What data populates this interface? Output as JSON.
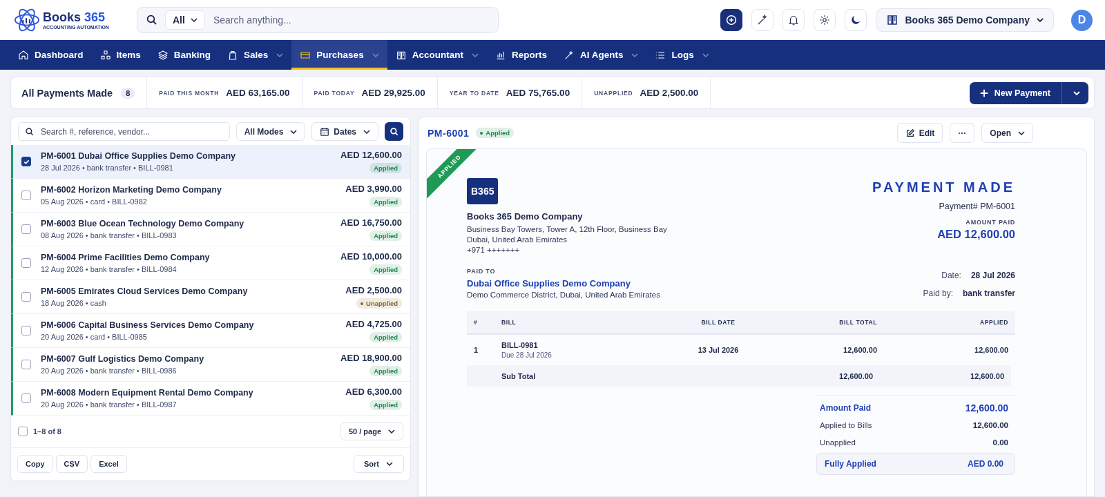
{
  "header": {
    "logo": {
      "word": "Books",
      "number": "365",
      "tagline": "ACCOUNTING AUTOMATION"
    },
    "search": {
      "scope": "All",
      "placeholder": "Search anything..."
    },
    "company": "Books 365 Demo Company",
    "avatar": "D"
  },
  "nav": [
    {
      "label": "Dashboard",
      "has_menu": false,
      "selected": false
    },
    {
      "label": "Items",
      "has_menu": false,
      "selected": false
    },
    {
      "label": "Banking",
      "has_menu": false,
      "selected": false
    },
    {
      "label": "Sales",
      "has_menu": true,
      "selected": false
    },
    {
      "label": "Purchases",
      "has_menu": true,
      "selected": true
    },
    {
      "label": "Accountant",
      "has_menu": true,
      "selected": false
    },
    {
      "label": "Reports",
      "has_menu": false,
      "selected": false
    },
    {
      "label": "AI Agents",
      "has_menu": true,
      "selected": false
    },
    {
      "label": "Logs",
      "has_menu": true,
      "selected": false
    }
  ],
  "summary": {
    "title": "All Payments Made",
    "count": "8",
    "metrics": [
      {
        "label": "PAID THIS MONTH",
        "value": "AED 63,165.00"
      },
      {
        "label": "PAID TODAY",
        "value": "AED 29,925.00"
      },
      {
        "label": "YEAR TO DATE",
        "value": "AED 75,765.00"
      },
      {
        "label": "UNAPPLIED",
        "value": "AED 2,500.00"
      }
    ],
    "new_button": "New Payment"
  },
  "list": {
    "search_placeholder": "Search #, reference, vendor...",
    "mode_filter": "All Modes",
    "date_filter": "Dates",
    "rows": [
      {
        "title": "PM-6001 Dubai Office Supplies Demo Company",
        "meta": "28 Jul 2026 • bank transfer • BILL-0981",
        "amount": "AED 12,600.00",
        "status": "Applied",
        "color": "#1e8a4f",
        "dot": false,
        "checked": true,
        "selected": true
      },
      {
        "title": "PM-6002 Horizon Marketing Demo Company",
        "meta": "05 Aug 2026 • card • BILL-0982",
        "amount": "AED 3,990.00",
        "status": "Applied",
        "color": "#1e8a4f",
        "dot": false,
        "checked": false,
        "selected": false
      },
      {
        "title": "PM-6003 Blue Ocean Technology Demo Company",
        "meta": "08 Aug 2026 • bank transfer • BILL-0983",
        "amount": "AED 16,750.00",
        "status": "Applied",
        "color": "#1e8a4f",
        "dot": false,
        "checked": false,
        "selected": false
      },
      {
        "title": "PM-6004 Prime Facilities Demo Company",
        "meta": "12 Aug 2026 • bank transfer • BILL-0984",
        "amount": "AED 10,000.00",
        "status": "Applied",
        "color": "#1e8a4f",
        "dot": false,
        "checked": false,
        "selected": false
      },
      {
        "title": "PM-6005 Emirates Cloud Services Demo Company",
        "meta": "18 Aug 2026 • cash",
        "amount": "AED 2,500.00",
        "status": "Unapplied",
        "color": "#8a6a2a",
        "dot": true,
        "checked": false,
        "selected": false
      },
      {
        "title": "PM-6006 Capital Business Services Demo Company",
        "meta": "20 Aug 2026 • card • BILL-0985",
        "amount": "AED 4,725.00",
        "status": "Applied",
        "color": "#1e8a4f",
        "dot": false,
        "checked": false,
        "selected": false
      },
      {
        "title": "PM-6007 Gulf Logistics Demo Company",
        "meta": "20 Aug 2026 • bank transfer • BILL-0986",
        "amount": "AED 18,900.00",
        "status": "Applied",
        "color": "#1e8a4f",
        "dot": false,
        "checked": false,
        "selected": false
      },
      {
        "title": "PM-6008 Modern Equipment Rental Demo Company",
        "meta": "20 Aug 2026 • bank transfer • BILL-0987",
        "amount": "AED 6,300.00",
        "status": "Applied",
        "color": "#1e8a4f",
        "dot": false,
        "checked": false,
        "selected": false
      }
    ],
    "select_all_checked": false,
    "range": "1–8 of 8",
    "page_size": "50 / page",
    "export_buttons": [
      "Copy",
      "CSV",
      "Excel"
    ],
    "sort": "Sort"
  },
  "detail": {
    "number": "PM-6001",
    "status": "Applied",
    "color": "#1e8a4f",
    "dot": true,
    "actions": {
      "edit": "Edit",
      "more": "···",
      "open": "Open"
    },
    "document": {
      "ribbon": "APPLIED",
      "logo": "B365",
      "company": "Books 365 Demo Company",
      "address": [
        "Business Bay Towers, Tower A, 12th Floor, Business Bay",
        "Dubai, United Arab Emirates",
        "+971 +++++++"
      ],
      "title": "PAYMENT MADE",
      "payment_no": "Payment# PM-6001",
      "amount_label": "AMOUNT PAID",
      "amount": "AED 12,600.00",
      "paid_to_label": "PAID TO",
      "vendor": "Dubai Office Supplies Demo Company",
      "vendor_address": "Demo Commerce District, Dubai, United Arab Emirates",
      "facts": [
        {
          "label": "Date:",
          "value": "28 Jul 2026"
        },
        {
          "label": "Paid by:",
          "value": "bank transfer"
        }
      ],
      "columns": [
        "#",
        "BILL",
        "BILL DATE",
        "BILL TOTAL",
        "APPLIED"
      ],
      "rows": [
        {
          "index": "1",
          "bill": "BILL-0981",
          "due": "Due 28 Jul 2026",
          "date": "13 Jul 2026",
          "total": "12,600.00",
          "applied": "12,600.00"
        }
      ],
      "subtotal": {
        "label": "Sub Total",
        "total": "12,600.00",
        "applied": "12,600.00"
      },
      "totals": [
        {
          "label": "Amount Paid",
          "value": "12,600.00",
          "kind": "highlight"
        },
        {
          "label": "Applied to Bills",
          "value": "12,600.00",
          "kind": "plain"
        },
        {
          "label": "Unapplied",
          "value": "0.00",
          "kind": "plain"
        }
      ],
      "balance": {
        "label": "Fully Applied",
        "value": "AED 0.00"
      }
    }
  }
}
